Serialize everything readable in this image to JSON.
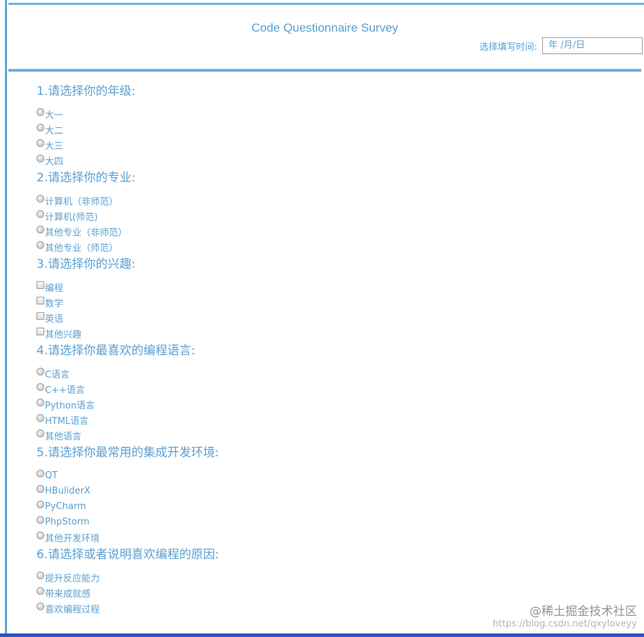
{
  "header": {
    "title": "Code Questionnaire Survey",
    "time_label": "选择填写时间:",
    "date_placeholder": "年 /月/日"
  },
  "questions": [
    {
      "title": "1.请选择你的年级:",
      "type": "radio",
      "options": [
        "大一",
        "大二",
        "大三",
        "大四"
      ]
    },
    {
      "title": "2.请选择你的专业:",
      "type": "radio",
      "options": [
        "计算机（非师范）",
        "计算机(师范)",
        "其他专业（非师范）",
        "其他专业（师范）"
      ]
    },
    {
      "title": "3.请选择你的兴趣:",
      "type": "checkbox",
      "options": [
        "编程",
        "数学",
        "英语",
        "其他兴趣"
      ]
    },
    {
      "title": "4.请选择你最喜欢的编程语言:",
      "type": "radio",
      "options": [
        "C语言",
        "C++语言",
        "Python语言",
        "HTML语言",
        "其他语言"
      ]
    },
    {
      "title": "5.请选择你最常用的集成开发环境:",
      "type": "radio",
      "options": [
        "QT",
        "HBuliderX",
        "PyCharm",
        "PhpStorm",
        "其他开发环境"
      ]
    },
    {
      "title": "6.请选择或者说明喜欢编程的原因:",
      "type": "radio",
      "options": [
        "提升反应能力",
        "带来成就感",
        "喜欢编程过程"
      ]
    }
  ],
  "watermark": {
    "main": "@稀土掘金技术社区",
    "url": "https://blog.csdn.net/qxyloveyy"
  },
  "colors": {
    "accent": "#5b9fd0",
    "rule": "#6db2dd",
    "bottom_bar": "#2a55b8"
  }
}
